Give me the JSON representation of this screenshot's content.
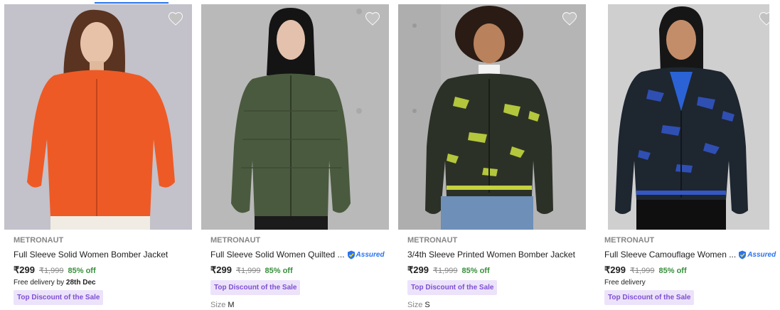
{
  "products": [
    {
      "brand": "METRONAUT",
      "title": "Full Sleeve Solid Women Bomber Jacket",
      "price": "₹299",
      "mrp": "₹1,999",
      "discount": "85% off",
      "delivery_prefix": "Free delivery by ",
      "delivery_date": "28th Dec",
      "badge": "Top Discount of the Sale",
      "jacket_color": "#ee5a25"
    },
    {
      "brand": "METRONAUT",
      "title": "Full Sleeve Solid Women Quilted ...",
      "assured": "Assured",
      "price": "₹299",
      "mrp": "₹1,999",
      "discount": "85% off",
      "badge": "Top Discount of the Sale",
      "size_label": "Size",
      "size_value": "M",
      "jacket_color": "#4a5a3f"
    },
    {
      "brand": "METRONAUT",
      "title": "3/4th Sleeve Printed Women Bomber Jacket",
      "price": "₹299",
      "mrp": "₹1,999",
      "discount": "85% off",
      "badge": "Top Discount of the Sale",
      "size_label": "Size",
      "size_value": "S",
      "jacket_color": "#2c3128"
    },
    {
      "brand": "METRONAUT",
      "title": "Full Sleeve Camouflage Women ...",
      "assured": "Assured",
      "price": "₹299",
      "mrp": "₹1,999",
      "discount": "85% off",
      "delivery": "Free delivery",
      "badge": "Top Discount of the Sale",
      "jacket_color": "#1e2630"
    }
  ],
  "colors": {
    "accent": "#2874f0",
    "discount_green": "#388e3c",
    "badge_bg": "#ece3fb",
    "badge_text": "#7e4fd1"
  }
}
